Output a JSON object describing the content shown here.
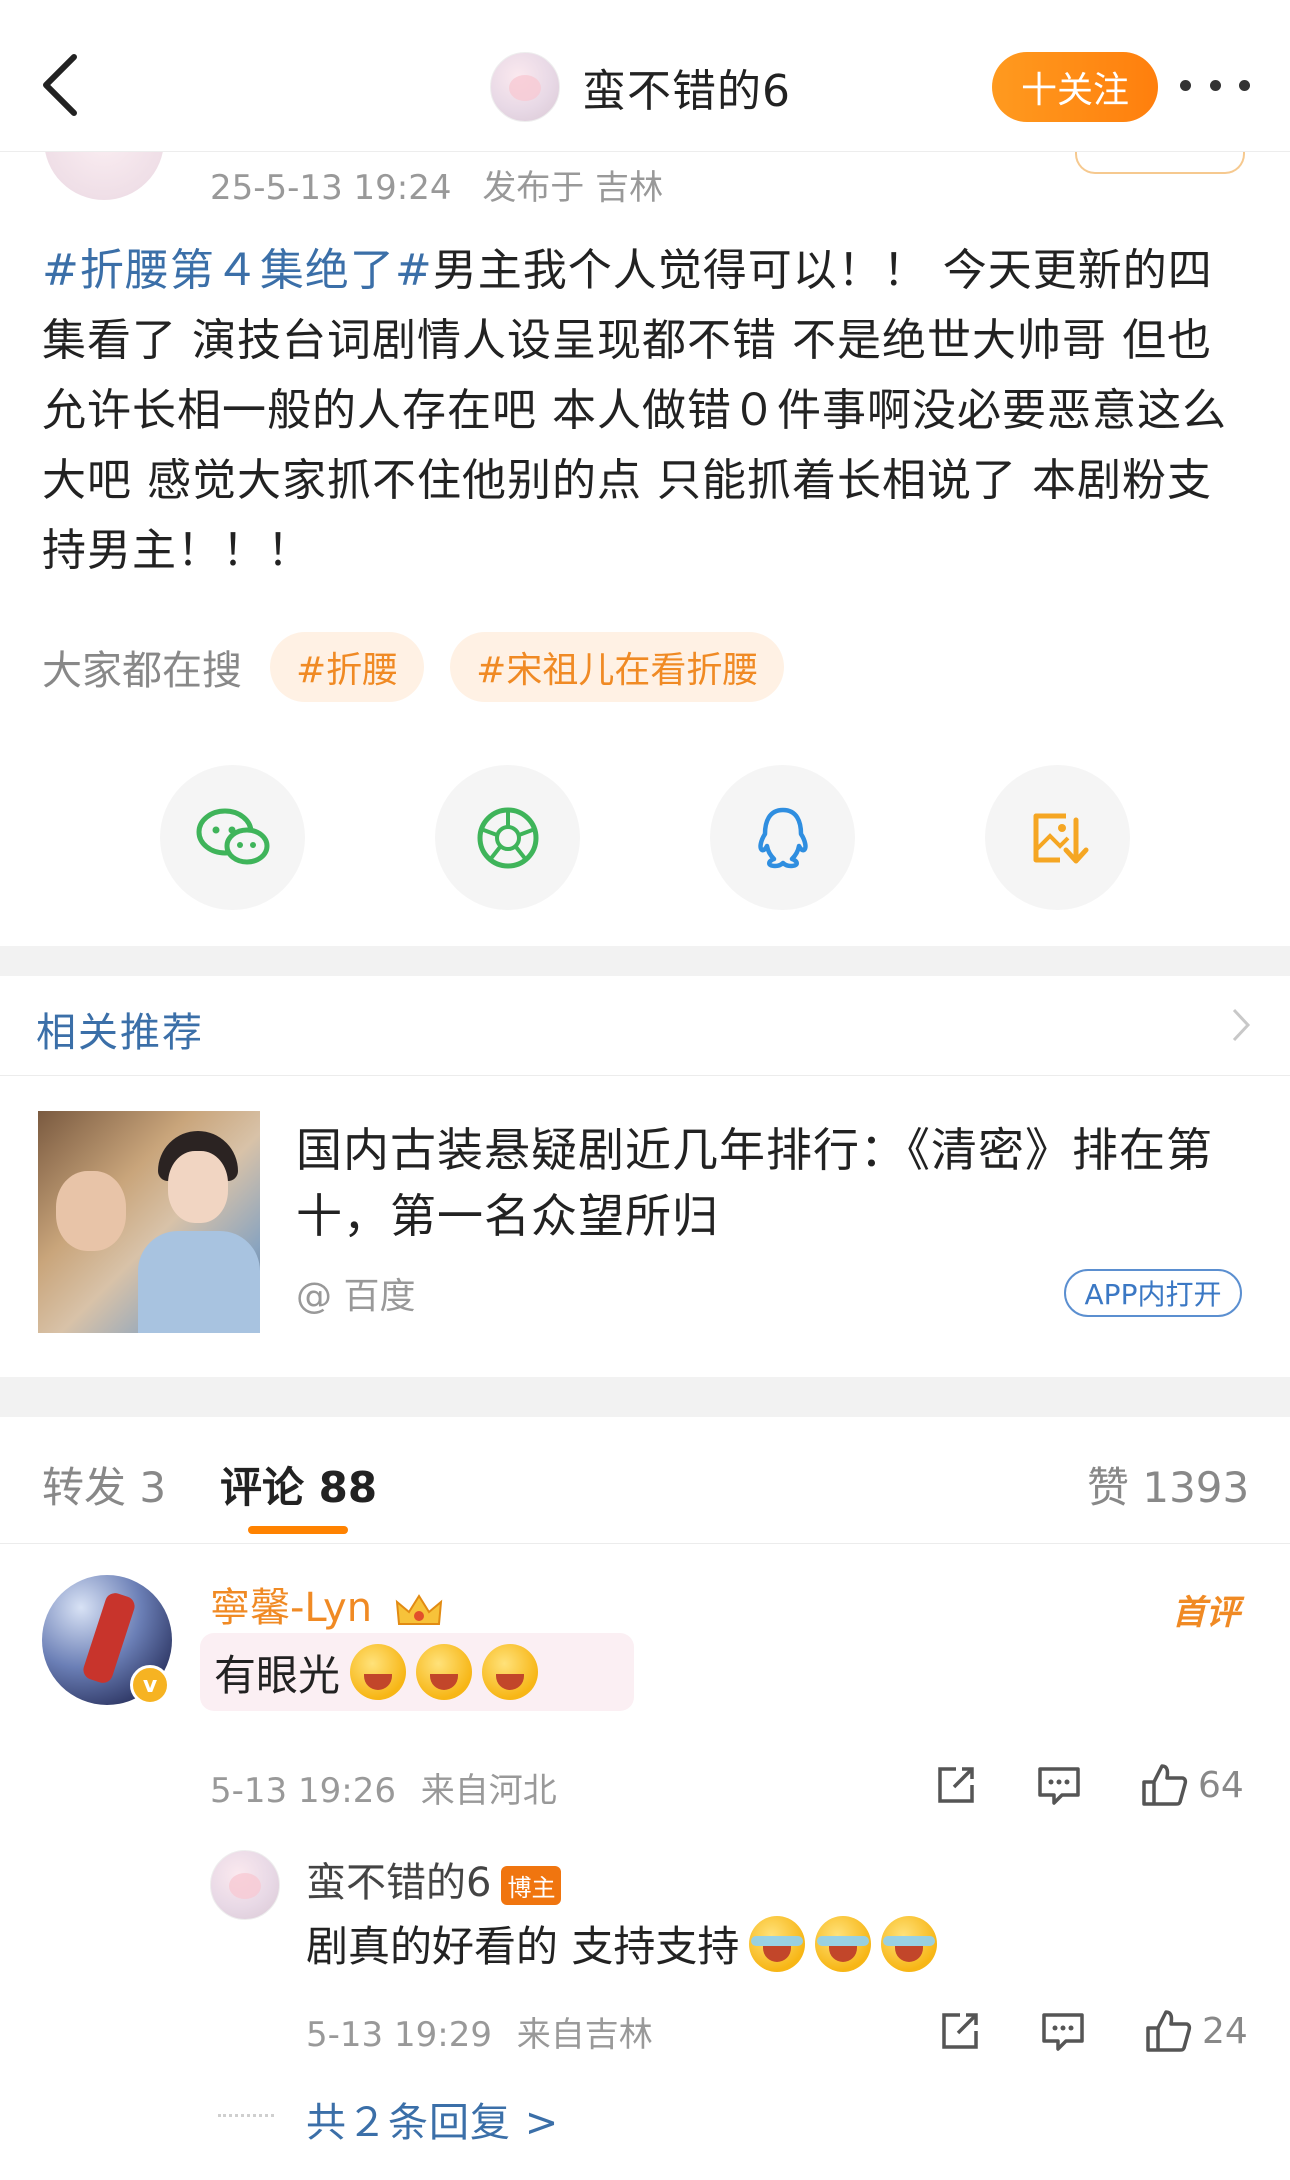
{
  "header": {
    "title": "蛮不错的6",
    "follow_label": "十关注"
  },
  "post": {
    "time": "25-5-13 19:24",
    "location": "发布于 吉林",
    "hashtag": "#折腰第４集绝了#",
    "body": "男主我个人觉得可以！！ 今天更新的四集看了 演技台词剧情人设呈现都不错 不是绝世大帅哥 但也允许长相一般的人存在吧 本人做错０件事啊没必要恶意这么大吧 感觉大家抓不住他别的点 只能抓着长相说了 本剧粉支持男主！！！"
  },
  "search": {
    "label": "大家都在搜",
    "chips": [
      "#折腰",
      "#宋祖儿在看折腰"
    ]
  },
  "share": {
    "icons": [
      "wechat-icon",
      "moments-icon",
      "qq-icon",
      "save-image-icon"
    ]
  },
  "related": {
    "heading": "相关推荐",
    "title": "国内古装悬疑剧近几年排行：《清密》排在第十，第一名众望所归",
    "source": "@ 百度",
    "open_label": "APP内打开"
  },
  "tabs": {
    "repost": "转发 3",
    "comments": "评论 88",
    "likes": "赞 1393"
  },
  "comment": {
    "name": "寧馨-Lyn",
    "first_badge": "首评",
    "text": "有眼光",
    "time": "5-13 19:26",
    "location": "来自河北",
    "like_count": "64",
    "verified_mark": "v"
  },
  "reply": {
    "name": "蛮不错的6",
    "badge": "博主",
    "text": "剧真的好看的 支持支持",
    "time": "5-13 19:29",
    "location": "来自吉林",
    "like_count": "24",
    "more": "共２条回复 >"
  },
  "colors": {
    "accent_orange": "#ff8200",
    "link_blue": "#3b6fa8",
    "chip_bg": "#fff1e4"
  }
}
